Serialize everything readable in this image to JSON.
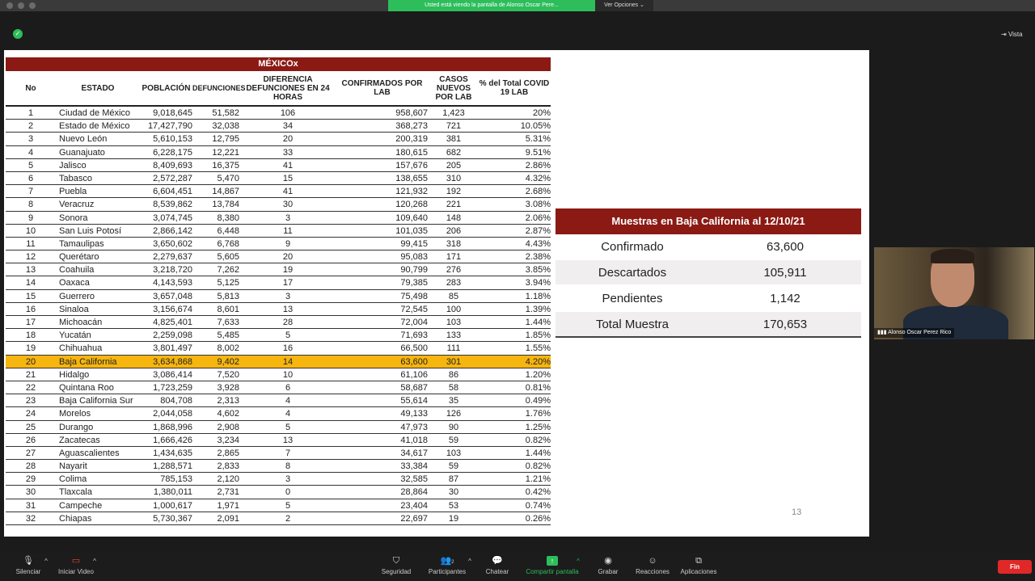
{
  "topbar": {
    "share_banner": "Usted está viendo la pantalla de Alonso Oscar Pere...",
    "view_options": "Ver Opciones ⌄",
    "vista": "Vista"
  },
  "table": {
    "title": "MÉXICOx",
    "headers": {
      "no": "No",
      "estado": "ESTADO",
      "poblacion": "POBLACIÓN",
      "defunciones": "DEFUNCIONES",
      "diferencia": "DIFERENCIA DEFUNCIONES EN 24 HORAS",
      "confirmados": "CONFIRMADOS POR LAB",
      "casos": "CASOS NUEVOS POR LAB",
      "pct": "% del Total COVID 19 LAB"
    },
    "rows": [
      [
        "1",
        "Ciudad de México",
        "9,018,645",
        "51,582",
        "106",
        "958,607",
        "1,423",
        "20%"
      ],
      [
        "2",
        "Estado de México",
        "17,427,790",
        "32,038",
        "34",
        "368,273",
        "721",
        "10.05%"
      ],
      [
        "3",
        "Nuevo León",
        "5,610,153",
        "12,795",
        "20",
        "200,319",
        "381",
        "5.31%"
      ],
      [
        "4",
        "Guanajuato",
        "6,228,175",
        "12,221",
        "33",
        "180,615",
        "682",
        "9.51%"
      ],
      [
        "5",
        "Jalisco",
        "8,409,693",
        "16,375",
        "41",
        "157,676",
        "205",
        "2.86%"
      ],
      [
        "6",
        "Tabasco",
        "2,572,287",
        "5,470",
        "15",
        "138,655",
        "310",
        "4.32%"
      ],
      [
        "7",
        "Puebla",
        "6,604,451",
        "14,867",
        "41",
        "121,932",
        "192",
        "2.68%"
      ],
      [
        "8",
        "Veracruz",
        "8,539,862",
        "13,784",
        "30",
        "120,268",
        "221",
        "3.08%"
      ],
      [
        "9",
        "Sonora",
        "3,074,745",
        "8,380",
        "3",
        "109,640",
        "148",
        "2.06%"
      ],
      [
        "10",
        "San Luis Potosí",
        "2,866,142",
        "6,448",
        "11",
        "101,035",
        "206",
        "2.87%"
      ],
      [
        "11",
        "Tamaulipas",
        "3,650,602",
        "6,768",
        "9",
        "99,415",
        "318",
        "4.43%"
      ],
      [
        "12",
        "Querétaro",
        "2,279,637",
        "5,605",
        "20",
        "95,083",
        "171",
        "2.38%"
      ],
      [
        "13",
        "Coahuila",
        "3,218,720",
        "7,262",
        "19",
        "90,799",
        "276",
        "3.85%"
      ],
      [
        "14",
        "Oaxaca",
        "4,143,593",
        "5,125",
        "17",
        "79,385",
        "283",
        "3.94%"
      ],
      [
        "15",
        "Guerrero",
        "3,657,048",
        "5,813",
        "3",
        "75,498",
        "85",
        "1.18%"
      ],
      [
        "16",
        "Sinaloa",
        "3,156,674",
        "8,601",
        "13",
        "72,545",
        "100",
        "1.39%"
      ],
      [
        "17",
        "Michoacán",
        "4,825,401",
        "7,633",
        "28",
        "72,004",
        "103",
        "1.44%"
      ],
      [
        "18",
        "Yucatán",
        "2,259,098",
        "5,485",
        "5",
        "71,693",
        "133",
        "1.85%"
      ],
      [
        "19",
        "Chihuahua",
        "3,801,497",
        "8,002",
        "16",
        "66,500",
        "111",
        "1.55%"
      ],
      [
        "20",
        "Baja California",
        "3,634,868",
        "9,402",
        "14",
        "63,600",
        "301",
        "4.20%"
      ],
      [
        "21",
        "Hidalgo",
        "3,086,414",
        "7,520",
        "10",
        "61,106",
        "86",
        "1.20%"
      ],
      [
        "22",
        "Quintana Roo",
        "1,723,259",
        "3,928",
        "6",
        "58,687",
        "58",
        "0.81%"
      ],
      [
        "23",
        "Baja California Sur",
        "804,708",
        "2,313",
        "4",
        "55,614",
        "35",
        "0.49%"
      ],
      [
        "24",
        "Morelos",
        "2,044,058",
        "4,602",
        "4",
        "49,133",
        "126",
        "1.76%"
      ],
      [
        "25",
        "Durango",
        "1,868,996",
        "2,908",
        "5",
        "47,973",
        "90",
        "1.25%"
      ],
      [
        "26",
        "Zacatecas",
        "1,666,426",
        "3,234",
        "13",
        "41,018",
        "59",
        "0.82%"
      ],
      [
        "27",
        "Aguascalientes",
        "1,434,635",
        "2,865",
        "7",
        "34,617",
        "103",
        "1.44%"
      ],
      [
        "28",
        "Nayarit",
        "1,288,571",
        "2,833",
        "8",
        "33,384",
        "59",
        "0.82%"
      ],
      [
        "29",
        "Colima",
        "785,153",
        "2,120",
        "3",
        "32,585",
        "87",
        "1.21%"
      ],
      [
        "30",
        "Tlaxcala",
        "1,380,011",
        "2,731",
        "0",
        "28,864",
        "30",
        "0.42%"
      ],
      [
        "31",
        "Campeche",
        "1,000,617",
        "1,971",
        "5",
        "23,404",
        "53",
        "0.74%"
      ],
      [
        "32",
        "Chiapas",
        "5,730,367",
        "2,091",
        "2",
        "22,697",
        "19",
        "0.26%"
      ]
    ]
  },
  "muestras": {
    "title": "Muestras en Baja California al 12/10/21",
    "rows": [
      {
        "label": "Confirmado",
        "value": "63,600"
      },
      {
        "label": "Descartados",
        "value": "105,911"
      },
      {
        "label": "Pendientes",
        "value": "1,142"
      },
      {
        "label": "Total Muestra",
        "value": "170,653"
      }
    ]
  },
  "page_number": "13",
  "video": {
    "name": "Alonso Oscar Perez Rico"
  },
  "toolbar": {
    "silenciar": "Silenciar",
    "iniciar_video": "Iniciar Video",
    "seguridad": "Seguridad",
    "participantes": "Participantes",
    "participantes_count": "2",
    "chatear": "Chatear",
    "compartir": "Compartir pantalla",
    "grabar": "Grabar",
    "reacciones": "Reacciones",
    "aplicaciones": "Aplicaciones",
    "fin": "Fin"
  }
}
